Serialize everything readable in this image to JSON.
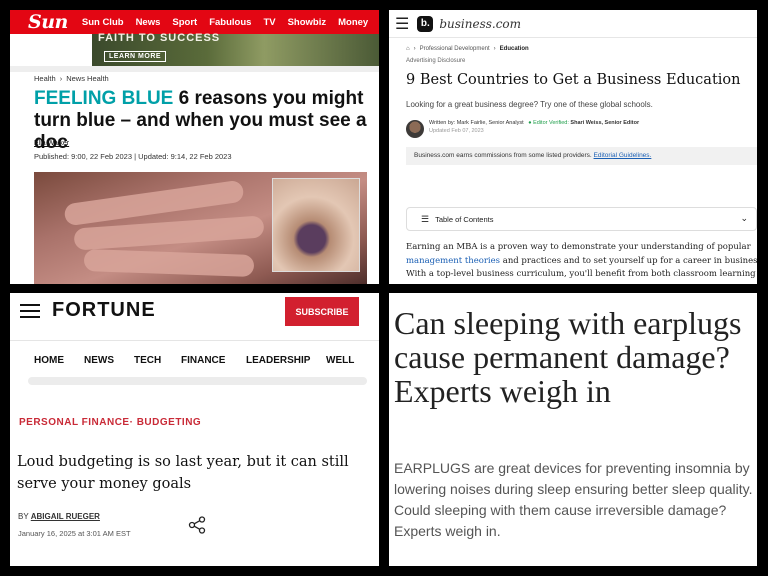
{
  "sun": {
    "logo": "Sun",
    "nav": [
      "Sun Club",
      "News",
      "Sport",
      "Fabulous",
      "TV",
      "Showbiz",
      "Money"
    ],
    "ad_text": "FAITH TO SUCCESS",
    "ad_button": "LEARN MORE",
    "breadcrumb": [
      "Health",
      "News Health"
    ],
    "headline_kicker": "FEELING BLUE",
    "headline": " 6 reasons you might turn blue – and when you must see a doc",
    "author": "Ella Walker",
    "published": "Published: 9:00, 22 Feb 2023 | Updated: 9:14, 22 Feb 2023"
  },
  "business": {
    "logo_letter": "b.",
    "logo_text": "business.com",
    "breadcrumb": [
      "Professional Development",
      "Education"
    ],
    "advertising": "Advertising Disclosure",
    "title": "9 Best Countries to Get a Business Education",
    "subtitle": "Looking for a great business degree? Try one of these global schools.",
    "written_by": "Written by: Mark Fairlie, Senior Analyst",
    "verified": "Editor Verified:",
    "editor": "Shari Weiss, Senior Editor",
    "updated": "Updated Feb 07, 2023",
    "disclosure": "Business.com earns commissions from some listed providers.",
    "disclosure_link": "Editorial Guidelines.",
    "toc": "Table of Contents",
    "body_1": "Earning an MBA is a proven way to demonstrate your understanding of popular",
    "body_link": "management theories",
    "body_2": " and practices and to set yourself up for a career in business.",
    "body_3": "With a top-level business curriculum, you'll benefit from both classroom learning a"
  },
  "fortune": {
    "logo": "FORTUNE",
    "subscribe": "SUBSCRIBE",
    "nav": [
      "HOME",
      "NEWS",
      "TECH",
      "FINANCE",
      "LEADERSHIP",
      "WELL"
    ],
    "category": "PERSONAL FINANCE· BUDGETING",
    "title": "Loud budgeting is so last year, but it can still serve your money goals",
    "by_prefix": "BY ",
    "author": "ABIGAIL RUEGER",
    "date": "January 16, 2025 at 3:01 AM EST"
  },
  "earplugs": {
    "title": "Can sleeping with earplugs cause permanent damage? Experts weigh in",
    "body": "EARPLUGS are great devices for preventing insomnia by lowering noises during sleep ensuring better sleep quality. Could sleeping with them cause irreversible damage? Experts weigh in."
  },
  "colors": {
    "sun_red": "#e30613",
    "sun_teal": "#00a0a8",
    "fortune_red": "#d2202f",
    "link_blue": "#1a5fb4"
  }
}
